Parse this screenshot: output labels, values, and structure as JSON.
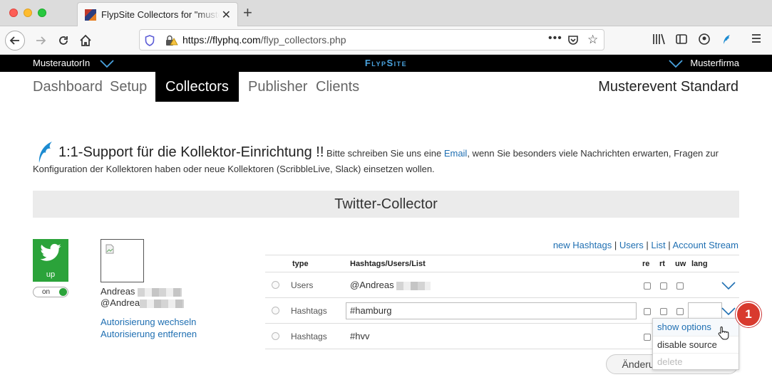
{
  "browser": {
    "tab_title": "FlypSite Collectors for \"musterf",
    "url_domain": "https://flyphq.com",
    "url_path": "/flyp_collectors.php"
  },
  "app": {
    "user": "MusterautorIn",
    "brand": "FlypSite",
    "organization": "Musterfirma",
    "nav": [
      "Dashboard",
      "Setup",
      "Collectors",
      "Publisher",
      "Clients"
    ],
    "active_nav": "Collectors",
    "event": "Musterevent Standard"
  },
  "support": {
    "headline": "1:1-Support für die Kollektor-Einrichtung !!",
    "text_before_link": " Bitte schreiben Sie uns eine ",
    "link": "Email",
    "text_after_link": ", wenn Sie besonders viele Nachrichten erwarten, Fragen zur",
    "line2": "Konfiguration der Kollektoren haben oder neue Kollektoren (ScribbleLive, Slack) einsetzen wollen."
  },
  "collector": {
    "title": "Twitter-Collector",
    "status": "up",
    "toggle": "on",
    "account_name": "Andreas",
    "account_handle": "@Andrea",
    "switch_auth": "Autorisierung wechseln",
    "remove_auth": "Autorisierung entfernen"
  },
  "links": {
    "new_hashtags": "new Hashtags",
    "users": "Users",
    "list": "List",
    "account_stream": "Account Stream",
    "sep": " | "
  },
  "table": {
    "headers": {
      "type": "type",
      "terms": "Hashtags/Users/List",
      "re": "re",
      "rt": "rt",
      "uw": "uw",
      "lang": "lang"
    },
    "rows": [
      {
        "type": "Users",
        "value": "@Andreas"
      },
      {
        "type": "Hashtags",
        "value": "#hamburg"
      },
      {
        "type": "Hashtags",
        "value": "#hvv"
      }
    ]
  },
  "dropdown": [
    "show options",
    "disable source",
    "delete"
  ],
  "badge": "1",
  "save_button": "Änderungen speichern",
  "colors": {
    "twitter_green": "#2ba33a",
    "link_blue": "#1f6fb2",
    "badge_red": "#d83a2e",
    "brand_blue": "#4aa3df"
  }
}
